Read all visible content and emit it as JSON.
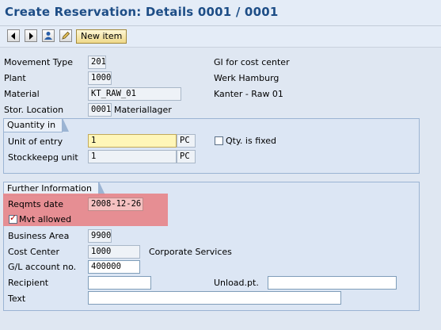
{
  "header": {
    "title": "Create Reservation: Details 0001 / 0001"
  },
  "toolbar": {
    "prev_icon": "triangle-left-icon",
    "next_icon": "triangle-right-icon",
    "person_icon": "person-icon",
    "pencil_icon": "pencil-icon",
    "new_item_label": "New item"
  },
  "header_fields": {
    "movement_type_label": "Movement Type",
    "movement_type_value": "201",
    "movement_type_text": "GI for cost center",
    "plant_label": "Plant",
    "plant_value": "1000",
    "plant_text": "Werk Hamburg",
    "material_label": "Material",
    "material_value": "KT_RAW_01",
    "material_text": "Kanter - Raw 01",
    "stor_location_label": "Stor. Location",
    "stor_location_value": "0001",
    "stor_location_text": "Materiallager"
  },
  "quantity": {
    "group_title": "Quantity in",
    "unit_entry_label": "Unit of entry",
    "unit_entry_value": "1",
    "unit_entry_uom": "PC",
    "qty_fixed_label": "Qty. is fixed",
    "qty_fixed_checked": false,
    "stockkeeping_label": "Stockkeepg unit",
    "stockkeeping_value": "1",
    "stockkeeping_uom": "PC"
  },
  "further": {
    "group_title": "Further Information",
    "reqmts_date_label": "Reqmts date",
    "reqmts_date_value": "2008-12-26",
    "mvt_allowed_label": "Mvt allowed",
    "mvt_allowed_checked": true,
    "business_area_label": "Business Area",
    "business_area_value": "9900",
    "cost_center_label": "Cost Center",
    "cost_center_value": "1000",
    "cost_center_text": "Corporate Services",
    "gl_account_label": "G/L account no.",
    "gl_account_value": "400000",
    "recipient_label": "Recipient",
    "recipient_value": "",
    "unload_pt_label": "Unload.pt.",
    "unload_pt_value": "",
    "text_label": "Text",
    "text_value": ""
  },
  "colors": {
    "title": "#1d4d86",
    "highlight": "#e6878a",
    "required_field": "#fff6b8"
  }
}
